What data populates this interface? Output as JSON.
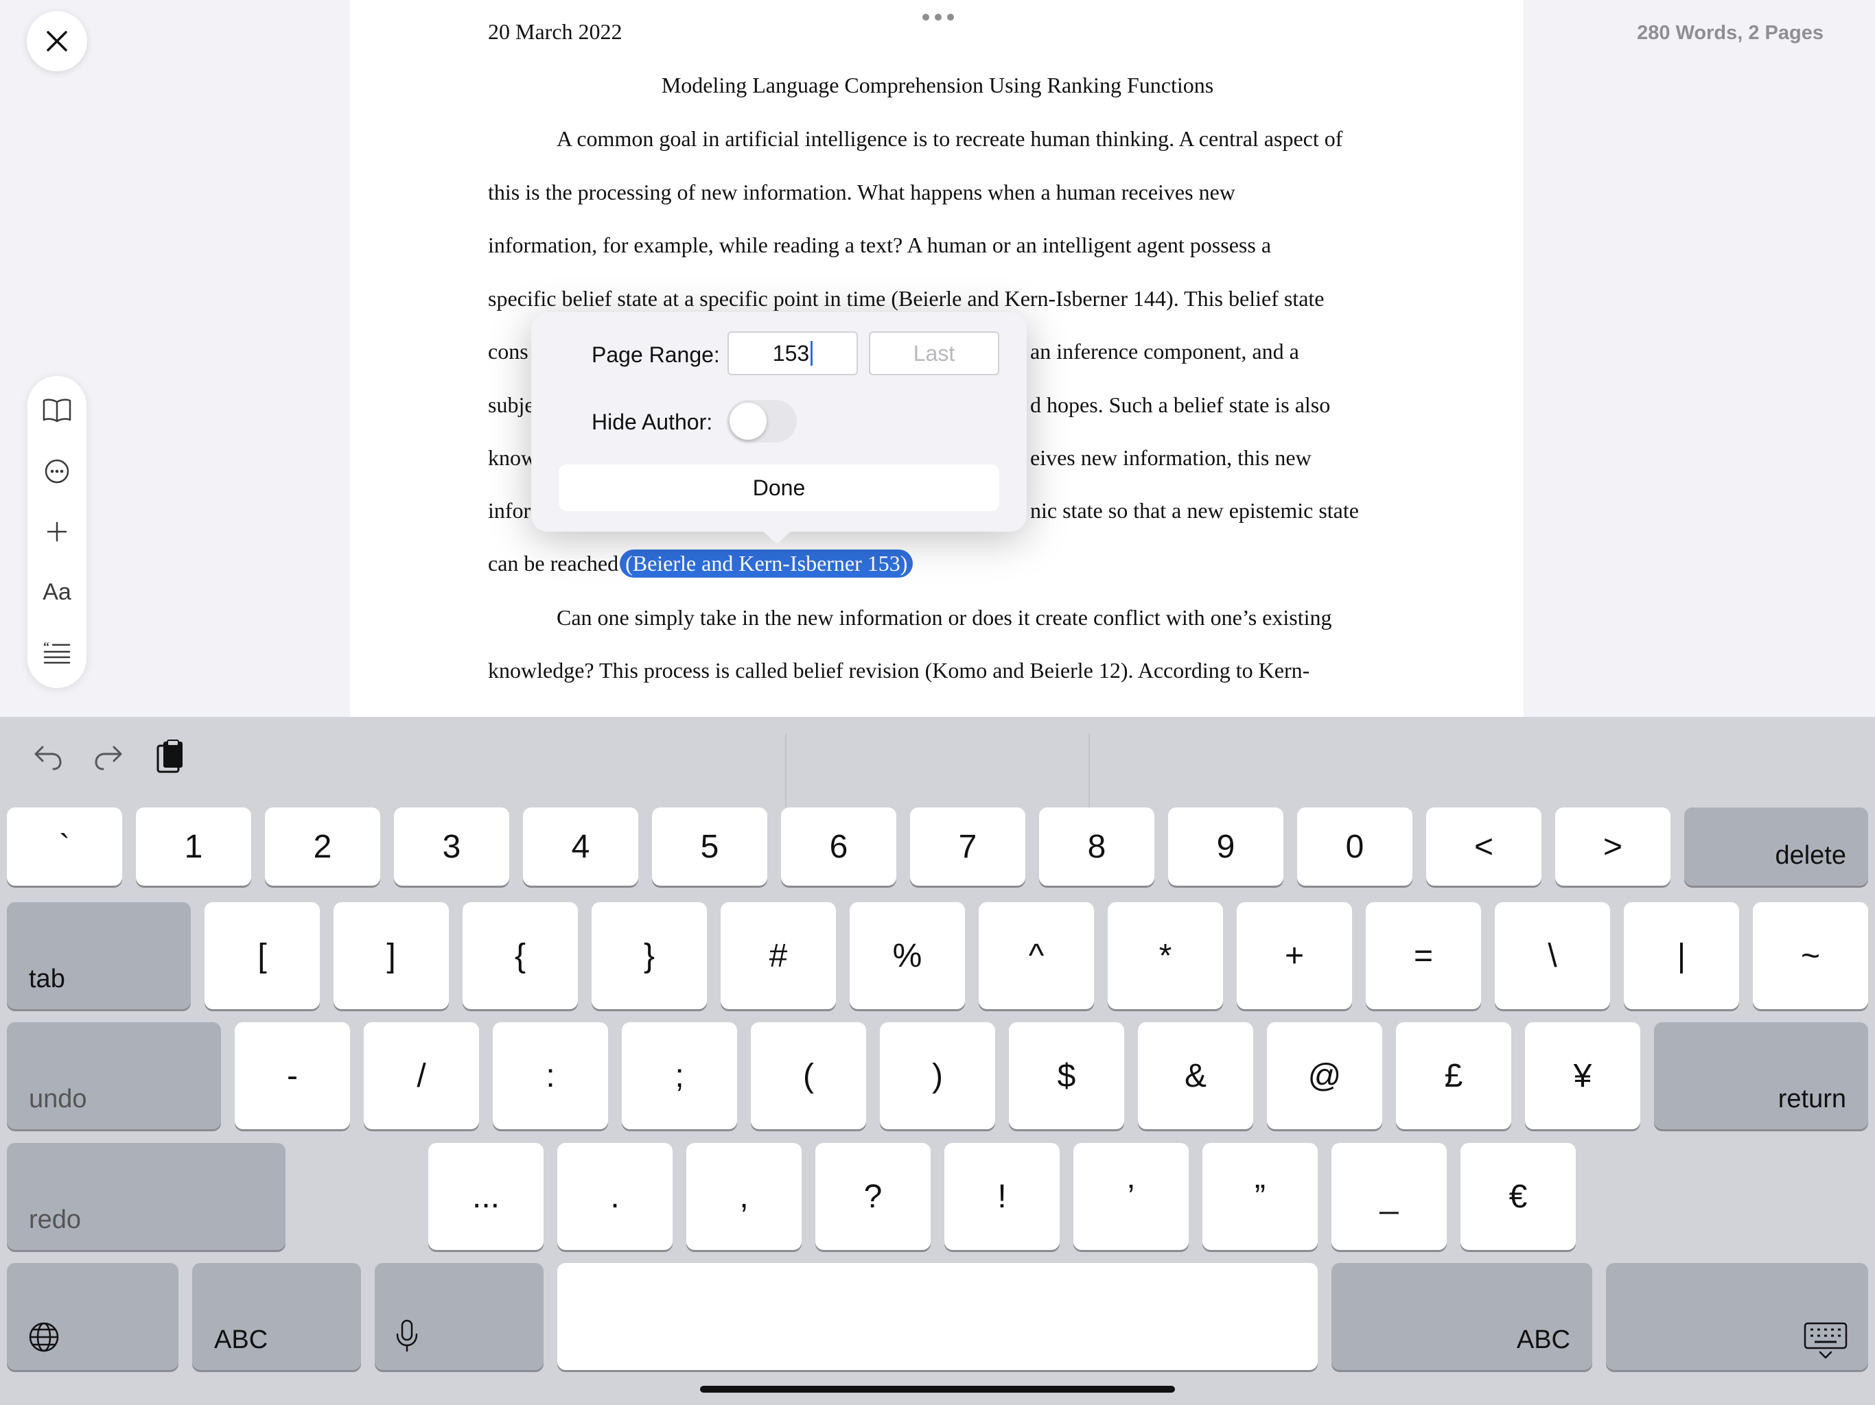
{
  "document": {
    "date": "20 March 2022",
    "title": "Modeling Language Comprehension Using Ranking Functions",
    "lines": [
      "A common goal in artificial intelligence is to recreate human thinking. A central aspect of",
      "this is the processing of new information. What happens when a human receives new",
      "information, for example, while reading a text? A human or an intelligent agent possess a",
      "specific belief state at a specific point in time (Beierle and Kern-Isberner 144). This belief state",
      "cons",
      "an inference component, and a",
      "subje",
      "d hopes. Such a belief state is also",
      "know",
      "eives new information, this new",
      "infor",
      "nic state so that a new epistemic state",
      "can be reached",
      "Can one simply take in the new information or does it create conflict with one’s existing",
      "knowledge? This process is called belief revision (Komo and Beierle 12). According to Kern-"
    ],
    "selected_citation": "(Beierle and Kern-Isberner 153)"
  },
  "stats": "280 Words, 2 Pages",
  "popover": {
    "page_range_label": "Page Range:",
    "page_start_value": "153",
    "page_end_placeholder": "Last",
    "hide_author_label": "Hide Author:",
    "hide_author_on": false,
    "done_label": "Done"
  },
  "toolbar": {
    "font_label": "Aa"
  },
  "keyboard": {
    "row1": [
      "`",
      "1",
      "2",
      "3",
      "4",
      "5",
      "6",
      "7",
      "8",
      "9",
      "0",
      "<",
      ">"
    ],
    "delete": "delete",
    "tab": "tab",
    "row2": [
      "[",
      "]",
      "{",
      "}",
      "#",
      "%",
      "^",
      "*",
      "+",
      "=",
      "\\",
      "|",
      "~"
    ],
    "undo": "undo",
    "row3": [
      "-",
      "/",
      ":",
      ";",
      "(",
      ")",
      "$",
      "&",
      "@",
      "£",
      "¥"
    ],
    "return": "return",
    "redo": "redo",
    "row4": [
      "...",
      ".",
      ",",
      "?",
      "!",
      "’",
      "”",
      "_",
      "€"
    ],
    "abc_left": "ABC",
    "abc_right": "ABC"
  }
}
